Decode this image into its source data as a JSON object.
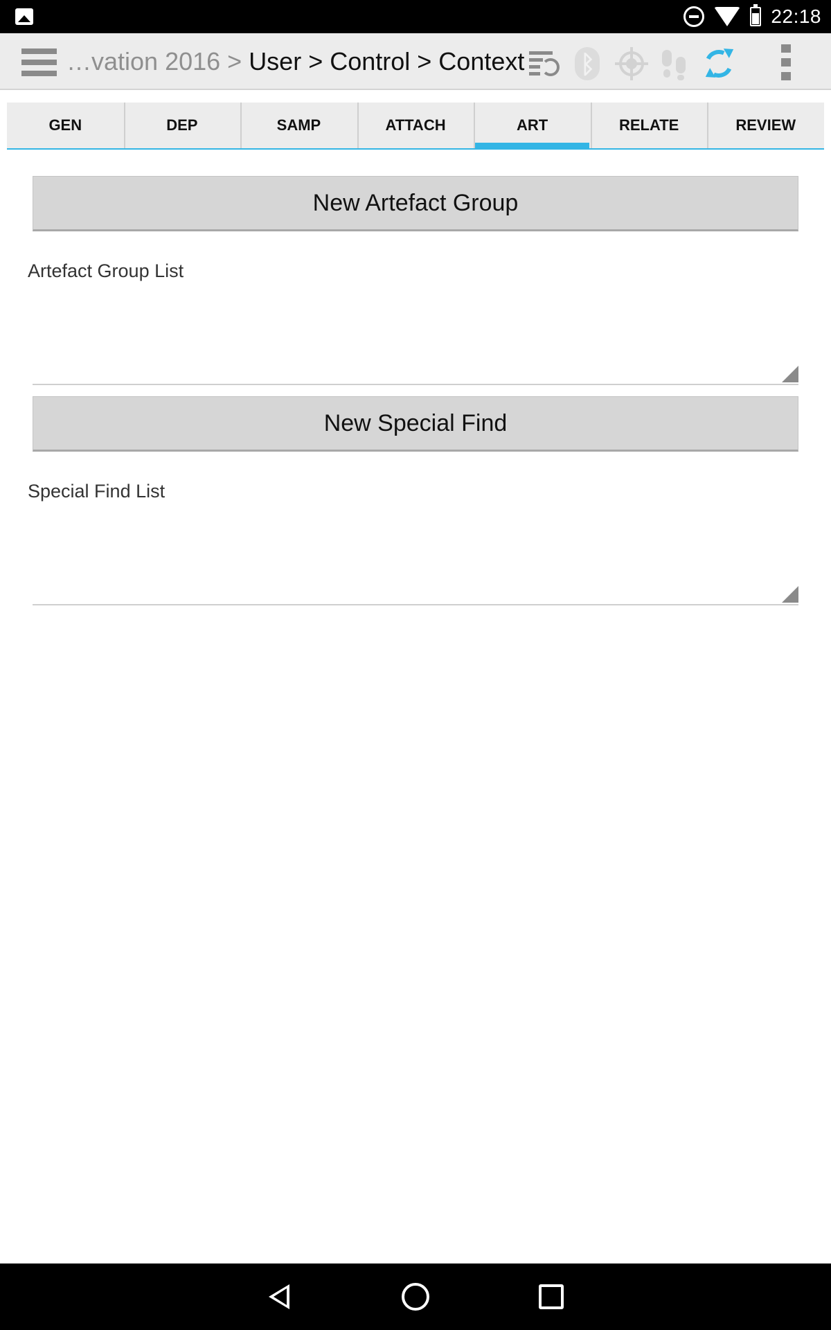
{
  "status_bar": {
    "time": "22:18",
    "icons": [
      "image-notification-icon",
      "do-not-disturb-icon",
      "wifi-icon",
      "battery-icon"
    ]
  },
  "action_bar": {
    "breadcrumb_faded": "…vation 2016 > ",
    "breadcrumb_active": "User > Control > Context",
    "icons": [
      "menu-icon",
      "sync-list-icon",
      "bluetooth-icon",
      "gps-icon",
      "footsteps-icon",
      "refresh-icon",
      "overflow-menu-icon"
    ],
    "accent_color": "#33b5e5"
  },
  "tabs": [
    {
      "label": "GEN",
      "active": false
    },
    {
      "label": "DEP",
      "active": false
    },
    {
      "label": "SAMP",
      "active": false
    },
    {
      "label": "ATTACH",
      "active": false
    },
    {
      "label": "ART",
      "active": true
    },
    {
      "label": "RELATE",
      "active": false
    },
    {
      "label": "REVIEW",
      "active": false
    }
  ],
  "content": {
    "new_artefact_group_label": "New Artefact Group",
    "artefact_group_list_label": "Artefact Group List",
    "new_special_find_label": "New Special Find",
    "special_find_list_label": "Special Find List"
  },
  "nav_bar": {
    "buttons": [
      "back-icon",
      "home-icon",
      "recents-icon"
    ]
  }
}
